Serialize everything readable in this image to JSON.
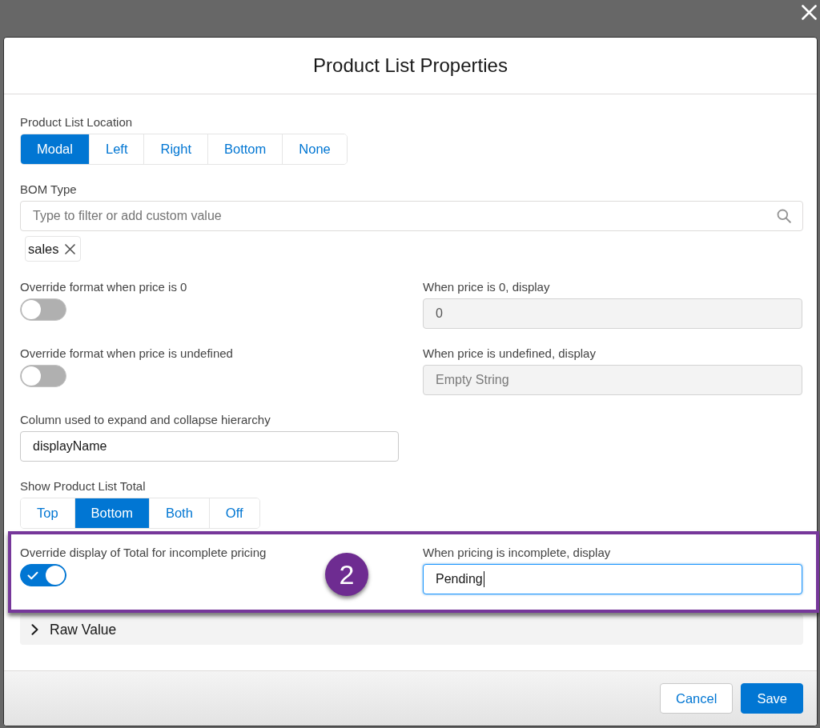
{
  "modal": {
    "title": "Product List Properties"
  },
  "sections": [
    {
      "kind": "button_group",
      "label": "Product List Location",
      "options": [
        {
          "label": "Modal",
          "selected": true
        },
        {
          "label": "Left",
          "selected": false
        },
        {
          "label": "Right",
          "selected": false
        },
        {
          "label": "Bottom",
          "selected": false
        },
        {
          "label": "None",
          "selected": false
        }
      ]
    },
    {
      "kind": "combobox",
      "label": "BOM Type",
      "placeholder": "Type to filter or add custom value",
      "pills": [
        {
          "label": "sales"
        }
      ]
    },
    {
      "kind": "toggle_pair",
      "toggle": {
        "label": "Override format when price is 0",
        "on": false
      },
      "field": {
        "label": "When price is 0, display",
        "value": "0",
        "disabled": true,
        "focused": false
      }
    },
    {
      "kind": "toggle_pair",
      "toggle": {
        "label": "Override format when price is undefined",
        "on": false
      },
      "field": {
        "label": "When price is undefined, display",
        "placeholder": "Empty String",
        "disabled": true,
        "focused": false
      }
    },
    {
      "kind": "text_input",
      "label": "Column used to expand and collapse hierarchy",
      "value": "displayName"
    },
    {
      "kind": "button_group",
      "label": "Show Product List Total",
      "options": [
        {
          "label": "Top",
          "selected": false
        },
        {
          "label": "Bottom",
          "selected": true
        },
        {
          "label": "Both",
          "selected": false
        },
        {
          "label": "Off",
          "selected": false
        }
      ]
    },
    {
      "kind": "toggle_pair",
      "highlighted": true,
      "callout": "2",
      "toggle": {
        "label": "Override display of Total for incomplete pricing",
        "on": true
      },
      "field": {
        "label": "When pricing is incomplete, display",
        "value": "Pending",
        "disabled": false,
        "focused": true
      }
    },
    {
      "kind": "accordion",
      "label": "Raw Value",
      "expanded": false
    }
  ],
  "footer": {
    "buttons": [
      {
        "label": "Cancel",
        "kind": "neutral"
      },
      {
        "label": "Save",
        "kind": "brand"
      }
    ]
  }
}
